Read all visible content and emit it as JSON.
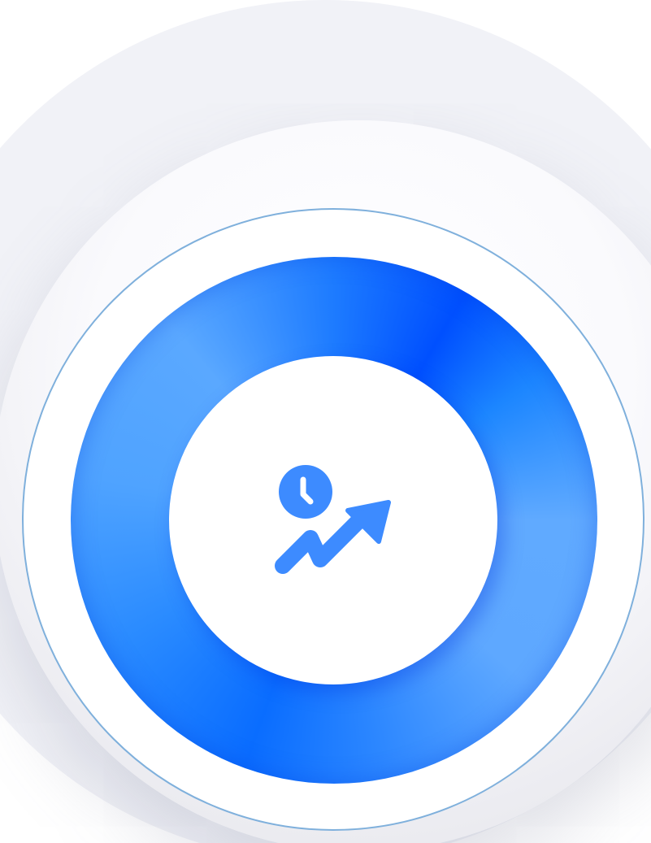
{
  "icon": {
    "name": "time-growth-icon",
    "color": "#3d8bff"
  },
  "colors": {
    "background": "#ffffff",
    "backdrop_disc": "#f1f2f7",
    "ring_outline": "#7fb0dc",
    "ring_primary": "#0a6dff",
    "ring_highlight": "#5aa8ff",
    "ring_deep": "#0050ff"
  }
}
